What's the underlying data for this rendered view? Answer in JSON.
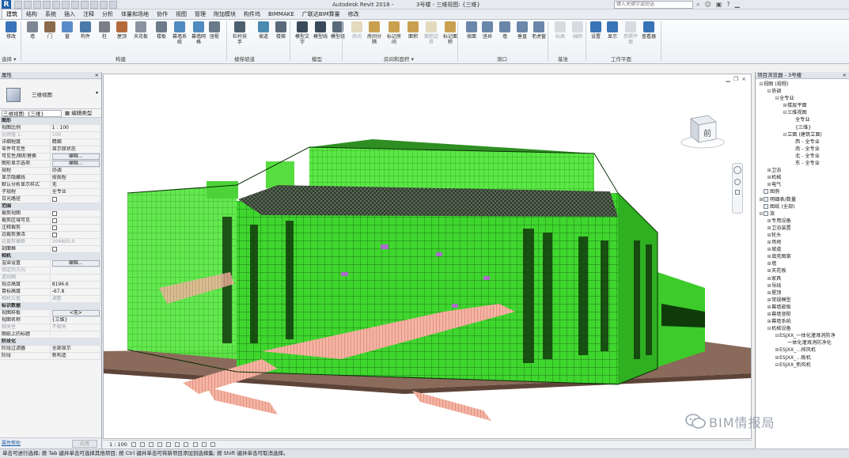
{
  "app": {
    "logo": "R",
    "title": "Autodesk Revit 2018 -",
    "view_title": "3号楼 - 三维视图: {三维}",
    "search_placeholder": "键入关键字或短语",
    "window_icons": [
      "search-icon",
      "user-icon",
      "cart-icon",
      "help-icon",
      "minimize-icon"
    ]
  },
  "tabs": [
    {
      "label": "建筑",
      "active": true
    },
    {
      "label": "结构"
    },
    {
      "label": "系统"
    },
    {
      "label": "插入"
    },
    {
      "label": "注释"
    },
    {
      "label": "分析"
    },
    {
      "label": "体量和场地"
    },
    {
      "label": "协作"
    },
    {
      "label": "视图"
    },
    {
      "label": "管理"
    },
    {
      "label": "附加模块"
    },
    {
      "label": "构件坞"
    },
    {
      "label": "BIMMAKE"
    },
    {
      "label": "广联达BIM算量"
    },
    {
      "label": "修改"
    }
  ],
  "ribbon": {
    "buttons": [
      {
        "label": "修改",
        "icon": "modify-cursor-icon"
      },
      {
        "label": "墙",
        "icon": "wall-icon"
      },
      {
        "label": "门",
        "icon": "door-icon"
      },
      {
        "label": "窗",
        "icon": "window-icon"
      },
      {
        "label": "构件",
        "icon": "component-icon"
      },
      {
        "label": "柱",
        "icon": "column-icon"
      },
      {
        "label": "屋顶",
        "icon": "roof-icon"
      },
      {
        "label": "天花板",
        "icon": "ceiling-icon"
      },
      {
        "label": "楼板",
        "icon": "floor-icon"
      },
      {
        "label": "幕墙系统",
        "icon": "curtain-system-icon"
      },
      {
        "label": "幕墙网格",
        "icon": "curtain-grid-icon"
      },
      {
        "label": "竖梃",
        "icon": "mullion-icon"
      },
      {
        "label": "栏杆扶手",
        "icon": "railing-icon"
      },
      {
        "label": "坡道",
        "icon": "ramp-icon"
      },
      {
        "label": "楼梯",
        "icon": "stair-icon"
      },
      {
        "label": "模型文字",
        "icon": "model-text-icon"
      },
      {
        "label": "模型线",
        "icon": "model-line-icon"
      },
      {
        "label": "模型组",
        "icon": "model-group-icon"
      },
      {
        "label": "房间",
        "icon": "room-icon",
        "dim": true
      },
      {
        "label": "房间分隔",
        "icon": "room-separator-icon"
      },
      {
        "label": "标记房间",
        "icon": "tag-room-icon"
      },
      {
        "label": "面积",
        "icon": "area-icon"
      },
      {
        "label": "面积边界",
        "icon": "area-boundary-icon",
        "dim": true
      },
      {
        "label": "标记面积",
        "icon": "tag-area-icon"
      },
      {
        "label": "按面",
        "icon": "by-face-icon"
      },
      {
        "label": "竖井",
        "icon": "shaft-icon"
      },
      {
        "label": "墙",
        "icon": "wall-opening-icon"
      },
      {
        "label": "垂直",
        "icon": "vertical-opening-icon"
      },
      {
        "label": "老虎窗",
        "icon": "dormer-icon"
      },
      {
        "label": "标高",
        "icon": "level-icon",
        "dim": true
      },
      {
        "label": "轴网",
        "icon": "grid-icon",
        "dim": true
      },
      {
        "label": "设置",
        "icon": "set-workplane-icon"
      },
      {
        "label": "显示",
        "icon": "show-workplane-icon"
      },
      {
        "label": "参照平面",
        "icon": "ref-plane-icon",
        "dim": true
      },
      {
        "label": "查看器",
        "icon": "viewer-icon"
      }
    ],
    "panels": [
      {
        "label": "选择 ▾"
      },
      {
        "label": "构建"
      },
      {
        "label": "楼梯坡道"
      },
      {
        "label": "模型"
      },
      {
        "label": "房间和面积 ▾"
      },
      {
        "label": "洞口"
      },
      {
        "label": "基准"
      },
      {
        "label": "工作平面"
      }
    ]
  },
  "properties": {
    "header": "属性",
    "type_name": "三维视图",
    "view_selector": "三维视图: {三维}",
    "edit_type": "编辑类型",
    "rows": [
      {
        "section": "图形"
      },
      {
        "k": "视图比例",
        "v": "1 : 100"
      },
      {
        "k": "比例值 1:",
        "v": "100",
        "dim": true
      },
      {
        "k": "详细程度",
        "v": "精细"
      },
      {
        "k": "零件可见性",
        "v": "显示原状态"
      },
      {
        "k": "可见性/图形替换",
        "v": "编辑...",
        "btn": true
      },
      {
        "k": "图形显示选项",
        "v": "编辑...",
        "btn": true
      },
      {
        "k": "规程",
        "v": "协调"
      },
      {
        "k": "显示隐藏线",
        "v": "按规程"
      },
      {
        "k": "默认分析显示样式",
        "v": "无"
      },
      {
        "k": "子规程",
        "v": "全专业"
      },
      {
        "k": "日光路径",
        "chk": true
      },
      {
        "section": "范围"
      },
      {
        "k": "裁剪视图",
        "chk": true
      },
      {
        "k": "裁剪区域可见",
        "chk": true
      },
      {
        "k": "注释裁剪",
        "chk": true
      },
      {
        "k": "远裁剪激活",
        "chk": true
      },
      {
        "k": "远裁剪偏移",
        "v": "304800.0",
        "dim": true
      },
      {
        "k": "剖面框",
        "chk": true
      },
      {
        "section": "相机"
      },
      {
        "k": "渲染设置",
        "v": "编辑...",
        "btn": true
      },
      {
        "k": "锁定的方向",
        "dim": true
      },
      {
        "k": "透视图",
        "dim": true
      },
      {
        "k": "视点高度",
        "v": "8196.6"
      },
      {
        "k": "目标高度",
        "v": "-67.8"
      },
      {
        "k": "相机位置",
        "v": "调整",
        "dim": true
      },
      {
        "section": "标识数据"
      },
      {
        "k": "视图样板",
        "v": "<无>",
        "btn": true
      },
      {
        "k": "视图名称",
        "v": "{三维}"
      },
      {
        "k": "相关性",
        "v": "不相关",
        "dim": true
      },
      {
        "k": "图纸上的标题"
      },
      {
        "section": "阶段化"
      },
      {
        "k": "阶段过滤器",
        "v": "全部显示"
      },
      {
        "k": "阶段",
        "v": "新构造"
      }
    ],
    "help_link": "属性帮助",
    "apply_label": "应用"
  },
  "viewport": {
    "view_controls": [
      "minimize-icon",
      "restore-icon",
      "close-icon"
    ],
    "viewcube_face": "前"
  },
  "view_control_bar": {
    "scale": "1 : 100"
  },
  "status": {
    "text": "单击可进行选择; 按 Tab 键并单击可选择其他项目; 按 Ctrl 键并单击可将新项目添加到选择集; 按 Shift 键并单击可取消选择。"
  },
  "browser": {
    "header": "项目浏览器 - 3号楼",
    "items": [
      {
        "level": 0,
        "toggle": "⊟",
        "label": "视图 (规程)"
      },
      {
        "level": 1,
        "toggle": "⊟",
        "label": "协调"
      },
      {
        "level": 2,
        "toggle": "⊟",
        "label": "全专业"
      },
      {
        "level": 3,
        "toggle": "⊞",
        "label": "楼层平面"
      },
      {
        "level": 3,
        "toggle": "⊟",
        "label": "三维视图"
      },
      {
        "level": 4,
        "toggle": "",
        "label": "全专业"
      },
      {
        "level": 4,
        "toggle": "",
        "label": "{三维}"
      },
      {
        "level": 3,
        "toggle": "⊟",
        "label": "立面 (建筑立面)"
      },
      {
        "level": 4,
        "toggle": "",
        "label": "西 - 全专业"
      },
      {
        "level": 4,
        "toggle": "",
        "label": "南 - 全专业"
      },
      {
        "level": 4,
        "toggle": "",
        "label": "北 - 全专业"
      },
      {
        "level": 4,
        "toggle": "",
        "label": "东 - 全专业"
      },
      {
        "level": 1,
        "toggle": "⊞",
        "label": "卫浴"
      },
      {
        "level": 1,
        "toggle": "⊞",
        "label": "机械"
      },
      {
        "level": 1,
        "toggle": "⊞",
        "label": "电气"
      },
      {
        "level": 0,
        "toggle": "",
        "label": "图例",
        "box": true
      },
      {
        "level": 0,
        "toggle": "⊞",
        "label": "明细表/数量",
        "box": true
      },
      {
        "level": 0,
        "toggle": "",
        "label": "图纸 (全部)",
        "box": true
      },
      {
        "level": 0,
        "toggle": "⊟",
        "label": "族",
        "box": true
      },
      {
        "level": 1,
        "toggle": "⊞",
        "label": "专用设备"
      },
      {
        "level": 1,
        "toggle": "⊞",
        "label": "卫浴装置"
      },
      {
        "level": 1,
        "toggle": "⊞",
        "label": "轮头"
      },
      {
        "level": 1,
        "toggle": "⊞",
        "label": "场地"
      },
      {
        "level": 1,
        "toggle": "⊞",
        "label": "坡道"
      },
      {
        "level": 1,
        "toggle": "⊞",
        "label": "填充图案"
      },
      {
        "level": 1,
        "toggle": "⊞",
        "label": "墙"
      },
      {
        "level": 1,
        "toggle": "⊞",
        "label": "天花板"
      },
      {
        "level": 1,
        "toggle": "⊞",
        "label": "家具"
      },
      {
        "level": 1,
        "toggle": "⊞",
        "label": "导线"
      },
      {
        "level": 1,
        "toggle": "⊞",
        "label": "屋顶"
      },
      {
        "level": 1,
        "toggle": "⊞",
        "label": "常规模型"
      },
      {
        "level": 1,
        "toggle": "⊞",
        "label": "幕墙嵌板"
      },
      {
        "level": 1,
        "toggle": "⊞",
        "label": "幕墙竖梃"
      },
      {
        "level": 1,
        "toggle": "⊞",
        "label": "幕墙系统"
      },
      {
        "level": 1,
        "toggle": "⊟",
        "label": "机械设备"
      },
      {
        "level": 2,
        "toggle": "⊟",
        "label": "ESJXX_一体化灌溉消防净"
      },
      {
        "level": 3,
        "toggle": "",
        "label": "一体化灌溉消防净化"
      },
      {
        "level": 2,
        "toggle": "⊞",
        "label": "ESJXX_…排风机"
      },
      {
        "level": 2,
        "toggle": "⊞",
        "label": "ESJXX_…板机"
      },
      {
        "level": 2,
        "toggle": "⊟",
        "label": "ESJXX_新风机"
      }
    ]
  },
  "watermark": {
    "text": "BIM情报局"
  },
  "colors": {
    "ribbon_blue": "#3a73b8",
    "model_green": "#35d427",
    "model_dark": "#1f6e14",
    "ground": "#8a6a5a",
    "stair_pink": "#f0a090"
  }
}
